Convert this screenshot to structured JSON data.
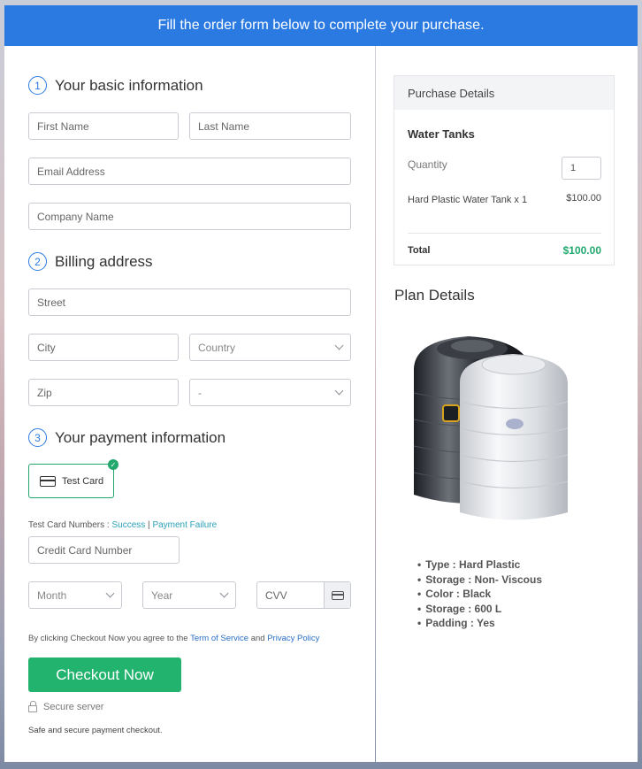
{
  "banner": {
    "text": "Fill the order form below to complete your purchase."
  },
  "basic": {
    "number": "1",
    "title": "Your basic information",
    "first_name_ph": "First Name",
    "last_name_ph": "Last Name",
    "email_ph": "Email Address",
    "company_ph": "Company Name"
  },
  "billing": {
    "number": "2",
    "title": "Billing address",
    "street_ph": "Street",
    "city_ph": "City",
    "country_selected": "Country",
    "zip_ph": "Zip",
    "state_selected": "-"
  },
  "payment": {
    "number": "3",
    "title": "Your payment information",
    "card_option": "Test Card",
    "test_numbers_label": "Test Card Numbers : ",
    "success_link": "Success",
    "separator": " | ",
    "failure_link": "Payment Failure",
    "card_number_ph": "Credit Card Number",
    "month_selected": "Month",
    "year_selected": "Year",
    "cvv_ph": "CVV"
  },
  "terms": {
    "prefix": "By clicking Checkout Now you agree to the ",
    "terms_link": "Term of Service",
    "and": " and ",
    "privacy_link": "Privacy Policy"
  },
  "checkout": {
    "button_label": "Checkout Now",
    "secure_label": "Secure server",
    "secure_note": "Safe and secure payment checkout."
  },
  "purchase_details": {
    "title": "Purchase Details",
    "product": "Water Tanks",
    "quantity_label": "Quantity",
    "quantity_value": "1",
    "item_label": "Hard Plastic Water Tank x 1",
    "item_price": "$100.00",
    "total_label": "Total",
    "total_value": "$100.00"
  },
  "plan": {
    "title": "Plan Details",
    "features": [
      "Type : Hard Plastic",
      "Storage : Non- Viscous",
      "Color : Black",
      "Storage : 600 L",
      "Padding : Yes"
    ]
  },
  "colors": {
    "accent": "#2a7ae2",
    "success": "#22b36e"
  },
  "icons": [
    "card-icon",
    "check-icon",
    "cvv-card-icon",
    "lock-icon",
    "chevron-down-icon"
  ]
}
